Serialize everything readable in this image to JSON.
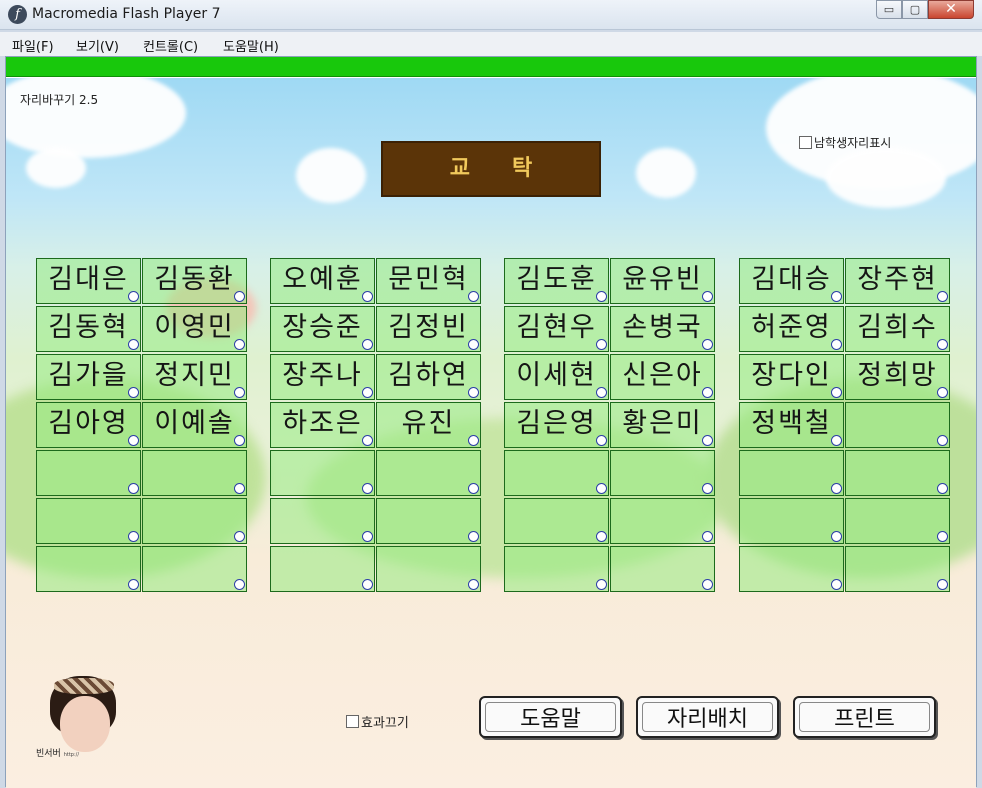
{
  "window": {
    "title": "Macromedia Flash Player 7",
    "app_icon_glyph": "f",
    "controls": {
      "minimize": "▭",
      "maximize": "▢",
      "close": "✕"
    }
  },
  "menu": [
    {
      "label": "파일(F)"
    },
    {
      "label": "보기(V)"
    },
    {
      "label": "컨트롤(C)"
    },
    {
      "label": "도움말(H)"
    }
  ],
  "app": {
    "version": "자리바꾸기 2.5",
    "podium": "교탁",
    "boy_seat_toggle": "남학생자리표시",
    "effects_off": "효과끄기",
    "buttons": {
      "help": "도움말",
      "arrange": "자리배치",
      "print": "프린트"
    },
    "avatar_caption": "빈서버",
    "avatar_url": "http://"
  },
  "seating": {
    "groups": [
      {
        "columns": [
          [
            "김대은",
            "김동혁",
            "김가을",
            "김아영",
            "",
            "",
            ""
          ],
          [
            "김동환",
            "이영민",
            "정지민",
            "이예솔",
            "",
            "",
            ""
          ]
        ]
      },
      {
        "columns": [
          [
            "오예훈",
            "장승준",
            "장주나",
            "하조은",
            "",
            "",
            ""
          ],
          [
            "문민혁",
            "김정빈",
            "김하연",
            "유진",
            "",
            "",
            ""
          ]
        ]
      },
      {
        "columns": [
          [
            "김도훈",
            "김현우",
            "이세현",
            "김은영",
            "",
            "",
            ""
          ],
          [
            "윤유빈",
            "손병국",
            "신은아",
            "황은미",
            "",
            "",
            ""
          ]
        ]
      },
      {
        "columns": [
          [
            "김대승",
            "허준영",
            "장다인",
            "정백철",
            "",
            "",
            ""
          ],
          [
            "장주현",
            "김희수",
            "정희망",
            "",
            "",
            "",
            ""
          ]
        ]
      }
    ]
  },
  "colors": {
    "progress_bar": "#18c80c",
    "podium_bg": "#5b3408",
    "podium_text": "#f1c95c",
    "seat_border": "#1c6a1c"
  }
}
